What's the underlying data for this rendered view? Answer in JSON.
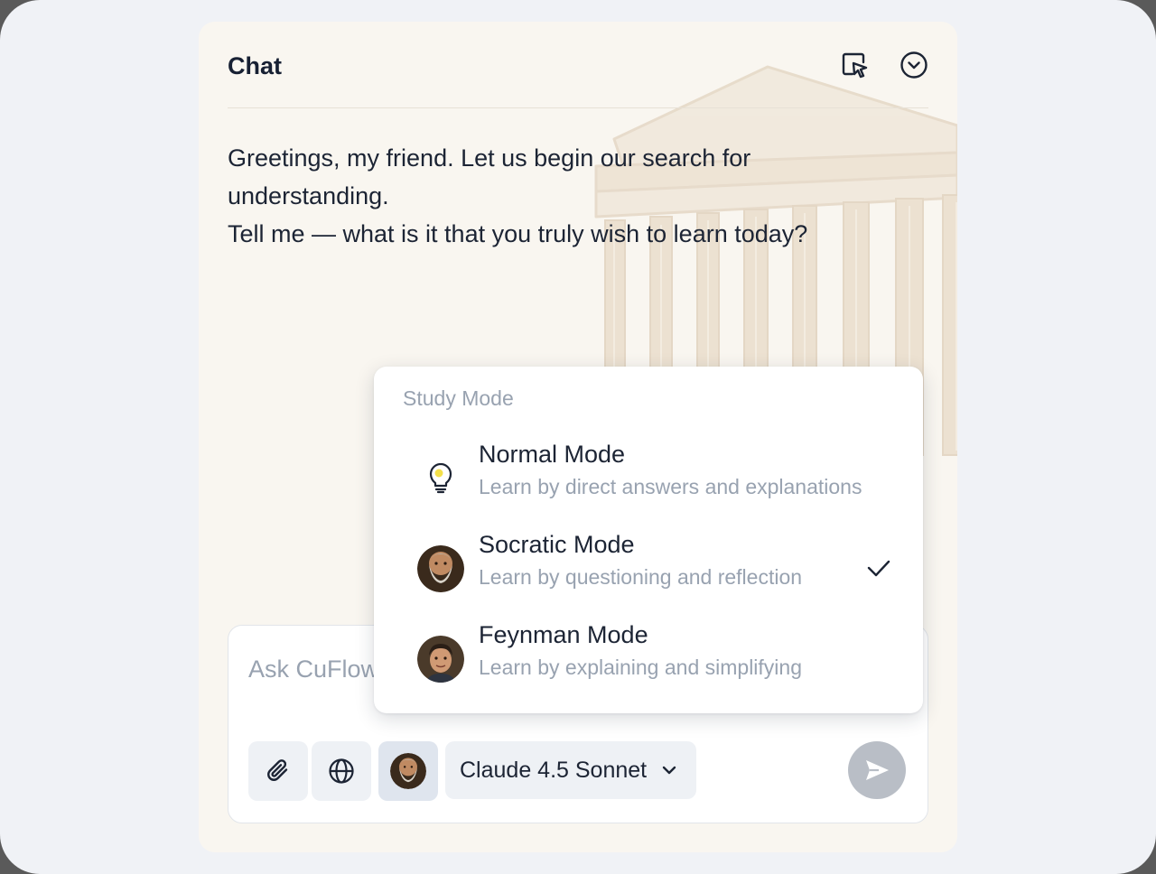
{
  "chat": {
    "title": "Chat",
    "header_icons": [
      "select-cursor-icon",
      "chevron-circle-down-icon"
    ],
    "message_lines": [
      "Greetings, my friend. Let us begin our search for understanding.",
      "Tell me — what is it that you truly wish to learn today?"
    ]
  },
  "composer": {
    "placeholder": "Ask CuFlow",
    "value": "",
    "model": "Claude 4.5 Sonnet",
    "tool_icons": [
      "paperclip-icon",
      "globe-icon",
      "socrates-avatar"
    ],
    "send_icon": "send-icon"
  },
  "study_menu": {
    "heading": "Study Mode",
    "items": [
      {
        "title": "Normal Mode",
        "description": "Learn by direct answers and explanations",
        "icon": "lightbulb-icon",
        "selected": false
      },
      {
        "title": "Socratic Mode",
        "description": "Learn by questioning and reflection",
        "icon": "socrates-avatar",
        "selected": true
      },
      {
        "title": "Feynman Mode",
        "description": "Learn by explaining and simplifying",
        "icon": "feynman-avatar",
        "selected": false
      }
    ]
  },
  "colors": {
    "page_bg": "#f0f2f6",
    "panel_bg": "#f9f6f0",
    "text_primary": "#1c2434",
    "text_muted": "#98a2b0",
    "send_disabled": "#b9bec6"
  }
}
